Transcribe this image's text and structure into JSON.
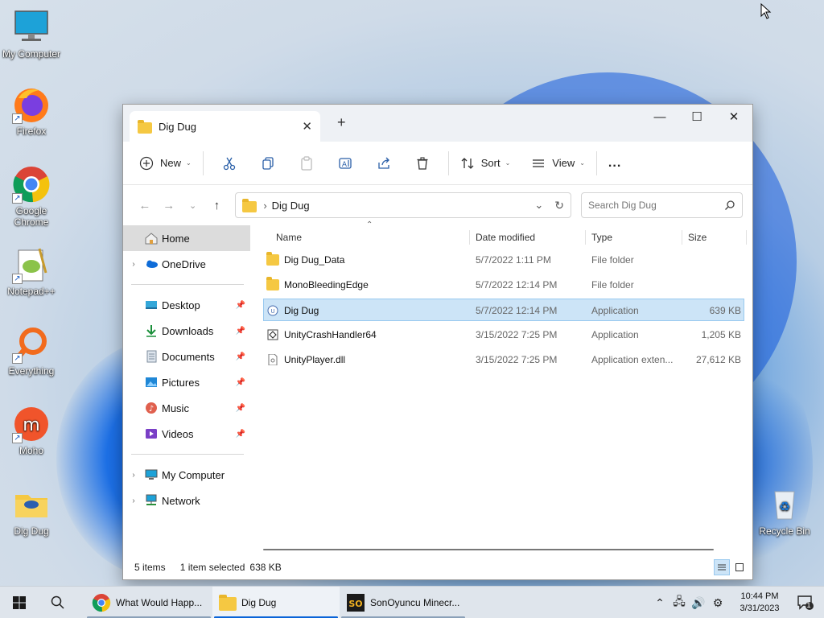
{
  "desktop": {
    "icons": [
      {
        "label": "My Computer"
      },
      {
        "label": "Firefox"
      },
      {
        "label": "Google Chrome"
      },
      {
        "label": "Notepad++"
      },
      {
        "label": "Everything"
      },
      {
        "label": "Moho"
      },
      {
        "label": "Dig Dug"
      },
      {
        "label": "Recycle Bin"
      }
    ]
  },
  "window": {
    "tab_title": "Dig Dug",
    "new_tab": "+",
    "controls": {
      "minimize": "—",
      "maximize": "☐",
      "close": "✕"
    },
    "toolbar": {
      "new_label": "New",
      "sort_label": "Sort",
      "view_label": "View",
      "more_label": "..."
    },
    "address": {
      "path": "Dig Dug"
    },
    "search": {
      "placeholder": "Search Dig Dug"
    },
    "sidebar": {
      "items": [
        {
          "label": "Home"
        },
        {
          "label": "OneDrive"
        },
        {
          "label": "Desktop"
        },
        {
          "label": "Downloads"
        },
        {
          "label": "Documents"
        },
        {
          "label": "Pictures"
        },
        {
          "label": "Music"
        },
        {
          "label": "Videos"
        },
        {
          "label": "My Computer"
        },
        {
          "label": "Network"
        }
      ]
    },
    "columns": {
      "name": "Name",
      "date": "Date modified",
      "type": "Type",
      "size": "Size"
    },
    "files": [
      {
        "name": "Dig Dug_Data",
        "date": "5/7/2022 1:11 PM",
        "type": "File folder",
        "size": ""
      },
      {
        "name": "MonoBleedingEdge",
        "date": "5/7/2022 12:14 PM",
        "type": "File folder",
        "size": ""
      },
      {
        "name": "Dig Dug",
        "date": "5/7/2022 12:14 PM",
        "type": "Application",
        "size": "639 KB"
      },
      {
        "name": "UnityCrashHandler64",
        "date": "3/15/2022 7:25 PM",
        "type": "Application",
        "size": "1,205 KB"
      },
      {
        "name": "UnityPlayer.dll",
        "date": "3/15/2022 7:25 PM",
        "type": "Application exten...",
        "size": "27,612 KB"
      }
    ],
    "status": {
      "items": "5 items",
      "selected": "1 item selected",
      "size": "638 KB"
    }
  },
  "taskbar": {
    "tasks": [
      {
        "label": "What Would Happ..."
      },
      {
        "label": "Dig Dug"
      },
      {
        "label": "SonOyuncu Minecr..."
      }
    ],
    "time": "10:44 PM",
    "date": "3/31/2023",
    "notification_count": "1"
  },
  "colors": {
    "accent": "#0a64d8",
    "selection": "#cce4f7",
    "folder": "#f5c842"
  }
}
